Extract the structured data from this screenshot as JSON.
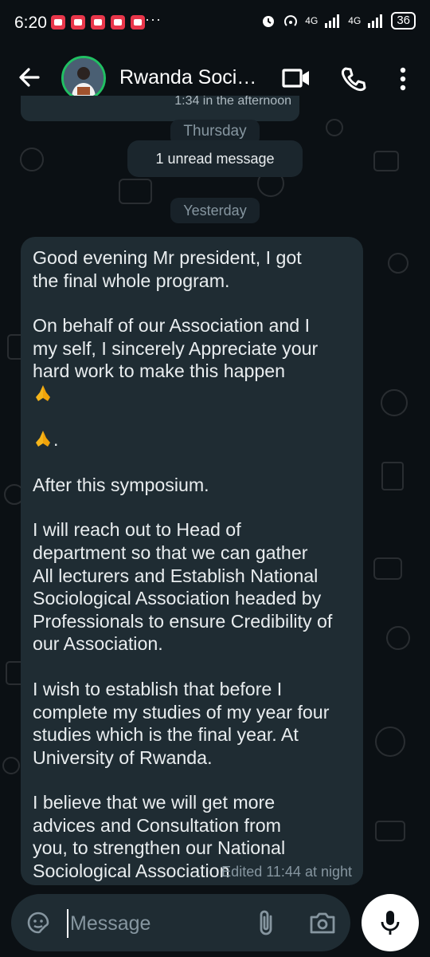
{
  "status_bar": {
    "time": "6:20",
    "more_indicator": "···",
    "network_1": "4G",
    "network_2": "4G",
    "battery": "36",
    "icons": [
      "notification-app-icon",
      "alarm-icon",
      "hotspot-icon",
      "signal-icon",
      "battery-icon"
    ]
  },
  "header": {
    "chat_title": "Rwanda Soci…",
    "icons": [
      "back-arrow-icon",
      "video-call-icon",
      "phone-call-icon",
      "more-vert-icon"
    ],
    "avatar_ring_color": "#21c063"
  },
  "conversation": {
    "prev_message_tail": "1:34 in the afternoon",
    "day_chip_1": "Thursday",
    "unread_chip": "1 unread message",
    "day_chip_2": "Yesterday",
    "message": {
      "paragraphs": [
        "Good evening Mr president, I got\nthe final whole program.",
        "On behalf of our Association and I\nmy self, I sincerely Appreciate your\nhard work to make this happen",
        "After this symposium.",
        "I will reach out to Head of\ndepartment so that we can gather\nAll lecturers and Establish National\nSociological Association headed by\nProfessionals to ensure Credibility of\nour Association.",
        "I wish to establish that before I\ncomplete my studies of my year four\nstudies which is the final year. At\nUniversity of Rwanda.",
        "I believe that we will get more\nadvices and Consultation from\nyou, to strengthen our National\nSociological Association"
      ],
      "emoji": "folded-hands-emoji",
      "trailing_period": ".",
      "edited_label": "Edited",
      "timestamp": "11:44 at night"
    }
  },
  "composer": {
    "placeholder": "Message",
    "icons": [
      "sticker-icon",
      "attach-icon",
      "camera-icon",
      "mic-icon"
    ]
  },
  "colors": {
    "background": "#0b1014",
    "bubble": "#1f2c33",
    "accent": "#21c063",
    "meta_text": "#8696a0"
  }
}
